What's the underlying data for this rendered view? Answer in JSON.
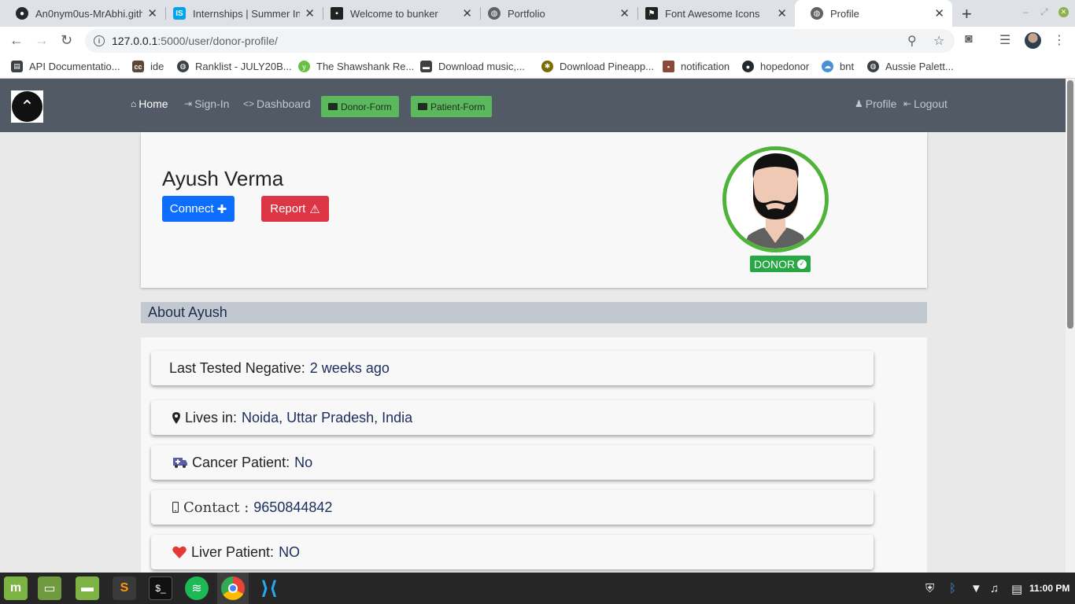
{
  "browser": {
    "tabs": [
      {
        "title": "An0nym0us-MrAbhi.githu",
        "icon": "github-icon",
        "color": "#24292e"
      },
      {
        "title": "Internships | Summer In",
        "icon": "internshala-icon",
        "color": "#00a5ec"
      },
      {
        "title": "Welcome to bunker",
        "icon": "bunker-icon",
        "color": "#222222"
      },
      {
        "title": "Portfolio",
        "icon": "globe-icon",
        "color": "#5f6368"
      },
      {
        "title": "Font Awesome Icons",
        "icon": "flag-icon",
        "color": "#222222"
      },
      {
        "title": "Profile",
        "icon": "globe-icon",
        "color": "#5f6368"
      }
    ],
    "url_host": "127.0.0.1",
    "url_path": ":5000/user/donor-profile/",
    "bookmarks": [
      {
        "label": "API Documentatio...",
        "icon": "book-icon",
        "color": "#3c4043"
      },
      {
        "label": "ide",
        "icon": "codechef-icon",
        "color": "#5b4638"
      },
      {
        "label": "Ranklist - JULY20B...",
        "icon": "globe-icon",
        "color": "#3c4043"
      },
      {
        "label": "The Shawshank Re...",
        "icon": "yts-icon",
        "color": "#6ac045"
      },
      {
        "label": "Download music,...",
        "icon": "car-icon",
        "color": "#3c4043"
      },
      {
        "label": "Download Pineapp...",
        "icon": "pineapple-icon",
        "color": "#7a6a00"
      },
      {
        "label": "notification",
        "icon": "image-icon",
        "color": "#8a4a3a"
      },
      {
        "label": "hopedonor",
        "icon": "github-icon",
        "color": "#24292e"
      },
      {
        "label": "bnt",
        "icon": "cloud-icon",
        "color": "#4a90d9"
      },
      {
        "label": "Aussie Palett...",
        "icon": "globe-icon",
        "color": "#3c4043"
      }
    ]
  },
  "site": {
    "nav": {
      "home": "Home",
      "signin": "Sign-In",
      "dashboard": "Dashboard",
      "donor_form": "Donor-Form",
      "patient_form": "Patient-Form",
      "profile": "Profile",
      "logout": "Logout"
    },
    "profile": {
      "name": "Ayush Verma",
      "connect": "Connect",
      "report": "Report",
      "badge": "DONOR",
      "accent": "#4fb33a"
    },
    "about": {
      "heading": "About Ayush",
      "rows": [
        {
          "label": "Last Tested Negative:",
          "value": "2 weeks ago",
          "icon": ""
        },
        {
          "label": "Lives in:",
          "value": "Noida, Uttar Pradesh, India",
          "icon": "map-marker-icon"
        },
        {
          "label": "Cancer Patient:",
          "value": "No",
          "icon": "ambulance-icon"
        },
        {
          "label": "Contact :",
          "value": "9650844842",
          "icon": "mobile-icon"
        },
        {
          "label": "Liver Patient:",
          "value": "NO",
          "icon": "heart-icon"
        }
      ]
    }
  },
  "taskbar": {
    "clock": "11:00 PM"
  }
}
